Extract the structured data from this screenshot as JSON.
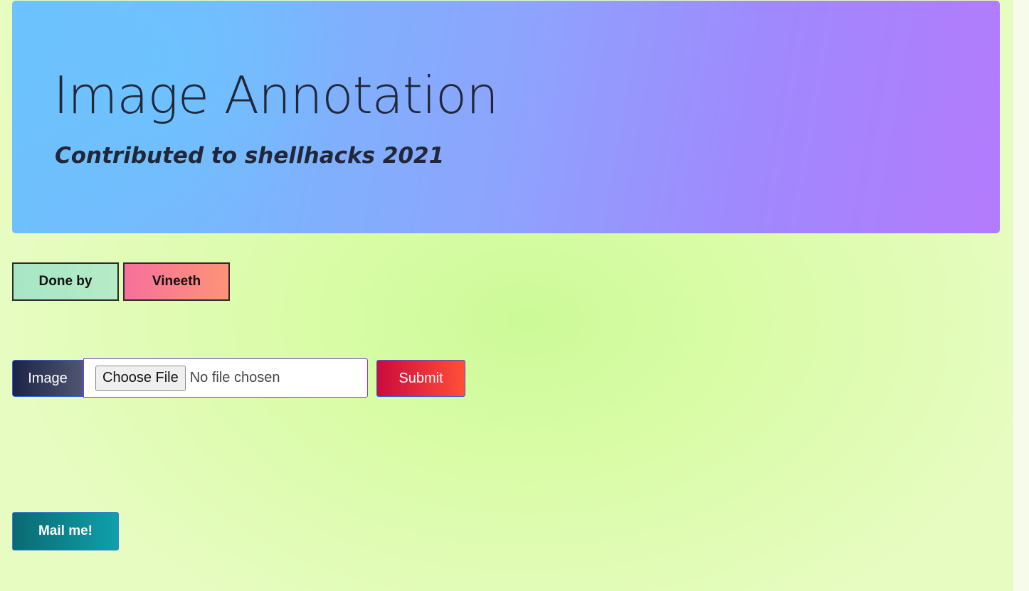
{
  "header": {
    "title": "Image Annotation",
    "subtitle_prefix": "Contributed to ",
    "subtitle_emphasis": "shellhacks 2021"
  },
  "credits": {
    "done_by_label": "Done by",
    "author_label": "Vineeth"
  },
  "upload_form": {
    "input_group_label": "Image",
    "choose_file_label": "Choose File",
    "file_status": "No file chosen",
    "submit_label": "Submit"
  },
  "contact": {
    "mail_label": "Mail me!"
  },
  "colors": {
    "header_gradient_start": "#6cc2fd",
    "header_gradient_end": "#b37bfd",
    "background": "#d6fca4",
    "submit_gradient_start": "#cc0a3e",
    "submit_gradient_end": "#ff4f38",
    "mail_gradient_start": "#0a6a72",
    "mail_gradient_end": "#0fa0ac"
  }
}
